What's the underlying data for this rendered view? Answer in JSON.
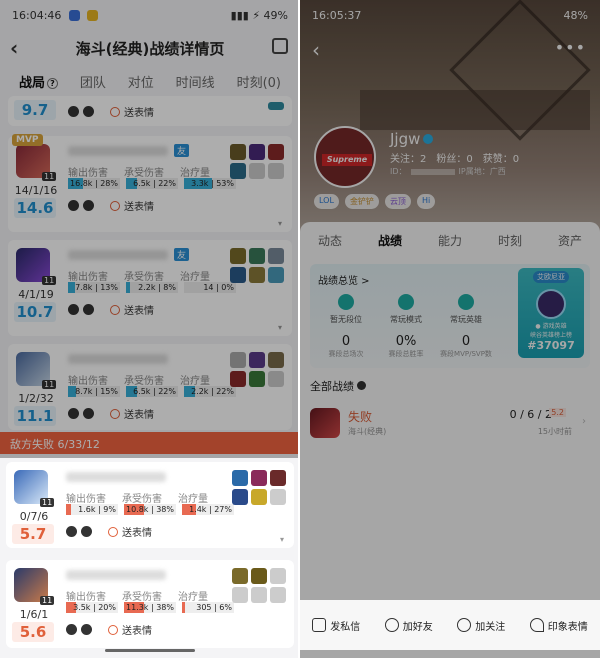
{
  "left": {
    "status": {
      "time": "16:04:46",
      "battery": "49%"
    },
    "title": "海斗(经典)战绩详情页",
    "tabs": [
      {
        "label": "战局"
      },
      {
        "label": "团队"
      },
      {
        "label": "对位"
      },
      {
        "label": "时间线"
      },
      {
        "label": "时刻(0)"
      }
    ],
    "top_partial": {
      "score": "9.7",
      "emote_label": "送表情"
    },
    "players_win": [
      {
        "kda": "14/1/16",
        "score": "14.6",
        "level": "11",
        "mvp": "MVP",
        "friend": "友",
        "bars": [
          {
            "label": "输出伤害",
            "text": "16.8k | 28%",
            "pct": 28
          },
          {
            "label": "承受伤害",
            "text": "6.5k | 22%",
            "pct": 22
          },
          {
            "label": "治疗量",
            "text": "3.3k | 53%",
            "pct": 53
          }
        ],
        "emote_label": "送表情"
      },
      {
        "kda": "4/1/19",
        "score": "10.7",
        "level": "11",
        "friend": "友",
        "bars": [
          {
            "label": "输出伤害",
            "text": "7.8k | 13%",
            "pct": 13
          },
          {
            "label": "承受伤害",
            "text": "2.2k | 8%",
            "pct": 8
          },
          {
            "label": "治疗量",
            "text": "14 | 0%",
            "pct": 0
          }
        ],
        "emote_label": "送表情"
      },
      {
        "kda": "1/2/32",
        "score": "11.1",
        "level": "11",
        "bars": [
          {
            "label": "输出伤害",
            "text": "8.7k | 15%",
            "pct": 15
          },
          {
            "label": "承受伤害",
            "text": "6.5k | 22%",
            "pct": 22
          },
          {
            "label": "治疗量",
            "text": "2.2k | 22%",
            "pct": 22
          }
        ],
        "emote_label": "送表情"
      }
    ],
    "lose_header": "敌方失败  6/33/12",
    "players_lose": [
      {
        "kda": "0/7/6",
        "score": "5.7",
        "level": "11",
        "bars": [
          {
            "label": "输出伤害",
            "text": "1.6k | 9%",
            "pct": 9
          },
          {
            "label": "承受伤害",
            "text": "10.8k | 38%",
            "pct": 38
          },
          {
            "label": "治疗量",
            "text": "1.4k | 27%",
            "pct": 27
          }
        ],
        "emote_label": "送表情"
      },
      {
        "kda": "1/6/1",
        "score": "5.6",
        "level": "11",
        "bars": [
          {
            "label": "输出伤害",
            "text": "3.5k | 20%",
            "pct": 20
          },
          {
            "label": "承受伤害",
            "text": "11.3k | 38%",
            "pct": 38
          },
          {
            "label": "治疗量",
            "text": "305 | 6%",
            "pct": 6
          }
        ],
        "emote_label": "送表情"
      }
    ]
  },
  "right": {
    "status": {
      "time": "16:05:37",
      "battery": "48%"
    },
    "username": "Jjgw",
    "follow": {
      "following": "关注：2",
      "fans": "粉丝：0",
      "likes": "获赞：0"
    },
    "id_prefix": "ID：",
    "ip": "IP属地：广西",
    "avatar_text": "Supreme",
    "tags": [
      "LOL",
      "金铲铲",
      "云顶",
      "Hi"
    ],
    "tabs": [
      "动态",
      "战绩",
      "能力",
      "时刻",
      "资产"
    ],
    "summary": {
      "title": "战绩总览 >",
      "items": [
        {
          "label": "暂无段位"
        },
        {
          "label": "常玩模式"
        },
        {
          "label": "常玩英雄"
        }
      ],
      "values": [
        {
          "value": "0",
          "label": "赛段总场次"
        },
        {
          "value": "0%",
          "label": "赛段总胜率"
        },
        {
          "value": "0",
          "label": "赛段MVP/SVP数"
        }
      ],
      "badge": {
        "label": "艾欧尼亚",
        "sub": "● 游戏英雄",
        "rank_text": "峡谷英雄榜上榜",
        "number": "#37097"
      }
    },
    "all_records": "全部战绩",
    "record": {
      "result": "失败",
      "mode": "海斗(经典)",
      "kda": "0 / 6 / 2",
      "score": "5.2",
      "time": "15小时前"
    },
    "toolbar": [
      "发私信",
      "加好友",
      "加关注",
      "印象表情"
    ]
  }
}
